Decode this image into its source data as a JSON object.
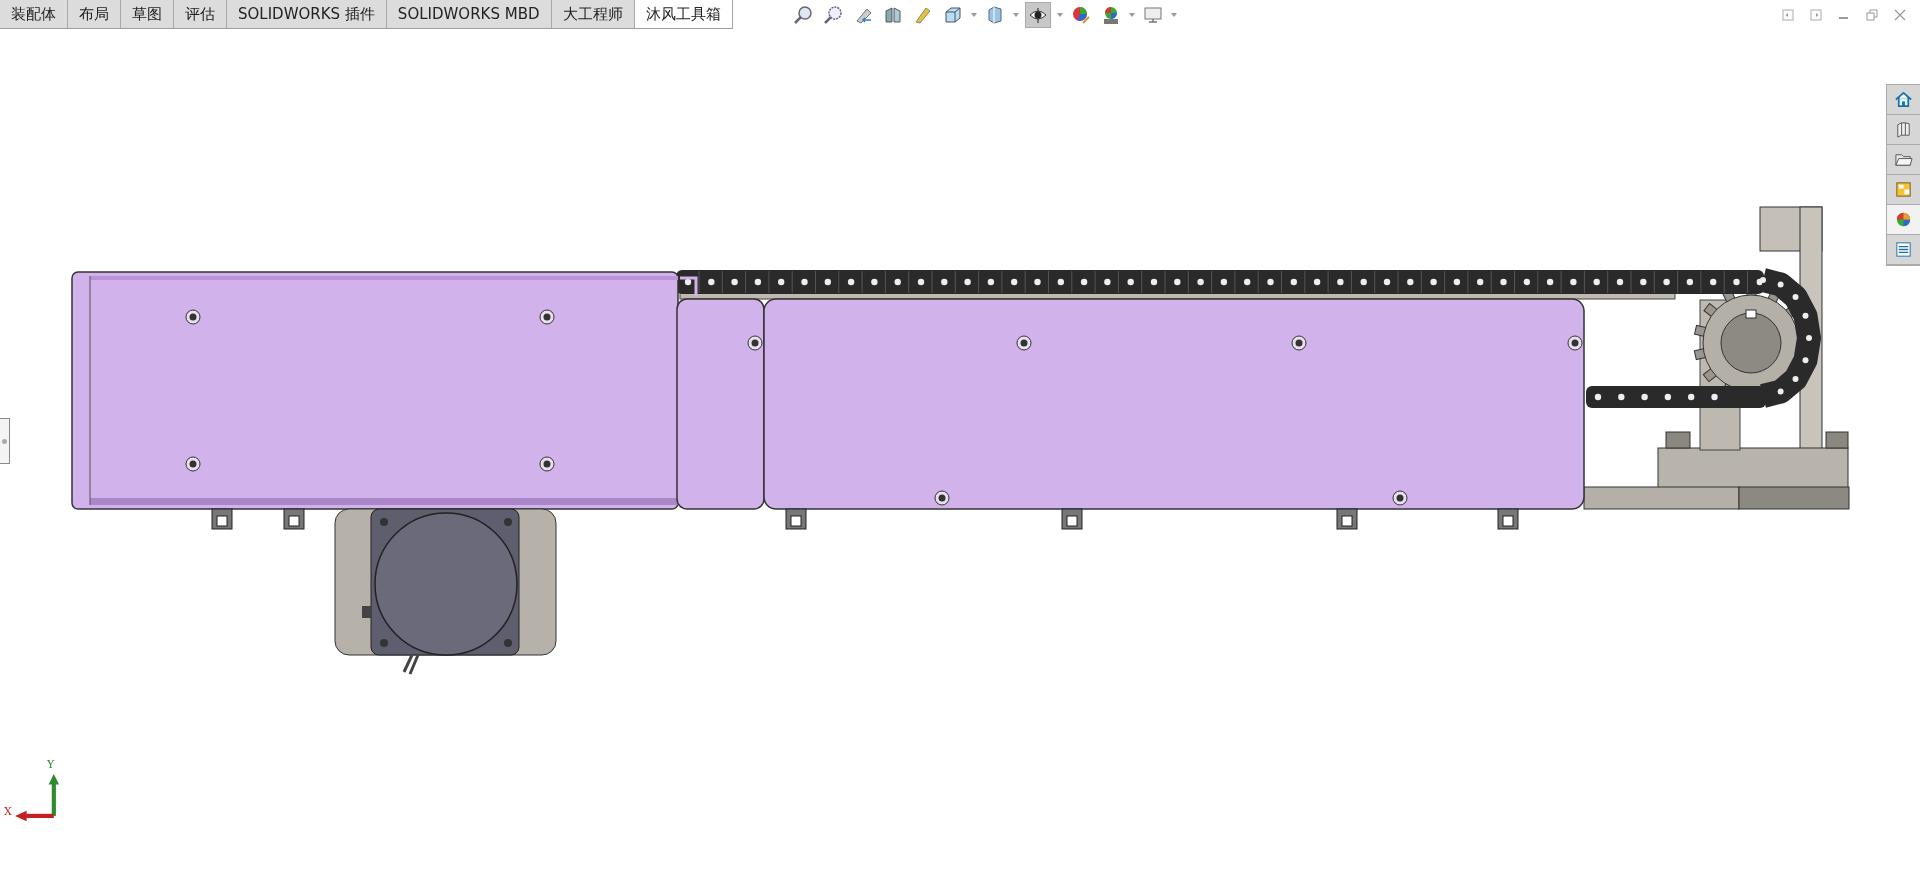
{
  "tabs": [
    {
      "label": "装配体",
      "selected": false
    },
    {
      "label": "布局",
      "selected": false
    },
    {
      "label": "草图",
      "selected": false
    },
    {
      "label": "评估",
      "selected": false
    },
    {
      "label": "SOLIDWORKS 插件",
      "selected": false
    },
    {
      "label": "SOLIDWORKS MBD",
      "selected": false
    },
    {
      "label": "大工程师",
      "selected": false
    },
    {
      "label": "沐风工具箱",
      "selected": true
    }
  ],
  "triad": {
    "x_label": "X",
    "y_label": "Y"
  }
}
